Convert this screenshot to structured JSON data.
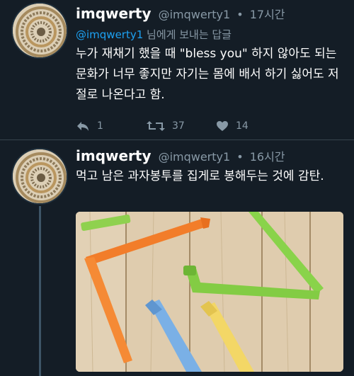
{
  "tweets": [
    {
      "name": "imqwerty",
      "handle": "@imqwerty1",
      "dot": "•",
      "time": "17시간",
      "reply_to": {
        "mention": "@imqwerty1",
        "suffix": " 님에게 보내는 답글"
      },
      "text": "누가 재채기 했을 때 \"bless you\" 하지 않아도 되는 문화가 너무 좋지만 자기는 몸에 배서 하기 싫어도 저절로 나온다고 함.",
      "stats": {
        "replies": "1",
        "retweets": "37",
        "likes": "14"
      }
    },
    {
      "name": "imqwerty",
      "handle": "@imqwerty1",
      "dot": "•",
      "time": "16시간",
      "text": "먹고 남은 과자봉투를 집게로 봉해두는 것에 감탄."
    }
  ],
  "icons": {
    "reply": "reply-icon",
    "retweet": "retweet-icon",
    "like": "heart-icon"
  },
  "colors": {
    "background": "#141d26",
    "link": "#1da1f2",
    "muted": "#8899a6"
  }
}
